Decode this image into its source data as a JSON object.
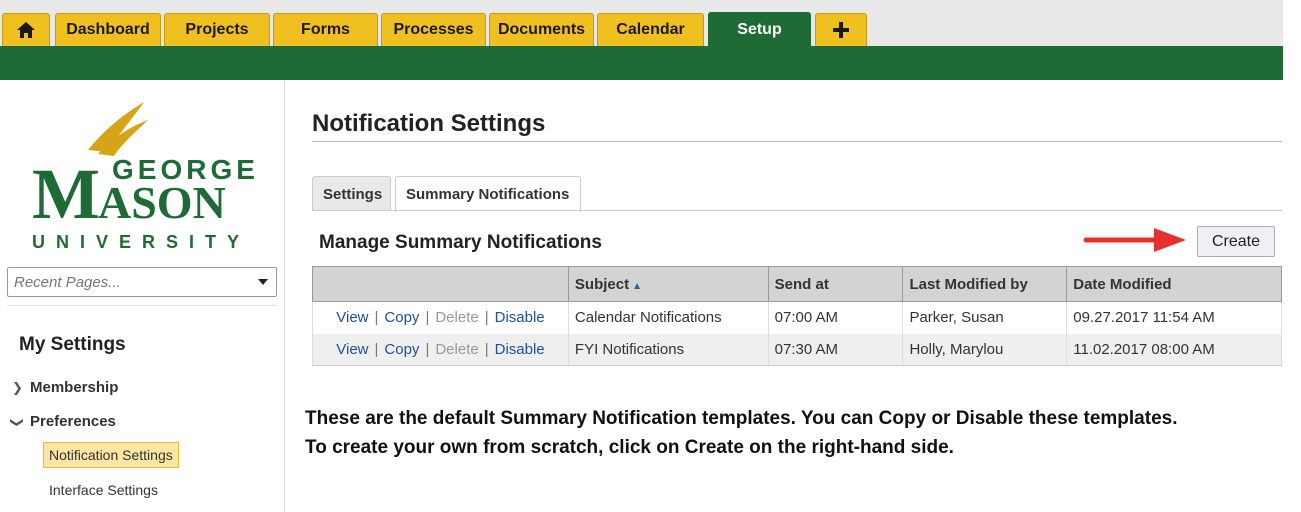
{
  "topnav": {
    "home_icon": "home-icon",
    "tabs": [
      "Dashboard",
      "Projects",
      "Forms",
      "Processes",
      "Documents",
      "Calendar",
      "Setup"
    ],
    "active_tab": "Setup",
    "add_icon": "plus-icon",
    "tab_color": "#f0c020",
    "active_color": "#1e6b35"
  },
  "sidebar": {
    "logo": {
      "line1": "GEORGE",
      "line2": "MASON",
      "line3": "UNIVERSITY"
    },
    "recent_placeholder": "Recent Pages...",
    "section_title": "My Settings",
    "items": [
      {
        "label": "Membership",
        "expanded": false
      },
      {
        "label": "Preferences",
        "expanded": true
      }
    ],
    "subitems": [
      {
        "label": "Notification Settings",
        "active": true
      },
      {
        "label": "Interface Settings",
        "active": false
      }
    ]
  },
  "main": {
    "page_title": "Notification Settings",
    "tabs": [
      {
        "label": "Settings",
        "active": false
      },
      {
        "label": "Summary Notifications",
        "active": true
      }
    ],
    "section_title": "Manage Summary Notifications",
    "create_label": "Create",
    "table": {
      "headers": [
        "",
        "Subject",
        "Send at",
        "Last Modified by",
        "Date Modified"
      ],
      "actions": [
        "View",
        "Copy",
        "Delete",
        "Disable"
      ],
      "rows": [
        {
          "subject": "Calendar Notifications",
          "send_at": "07:00 AM",
          "modified_by": "Parker, Susan",
          "date_modified": "09.27.2017 11:54 AM"
        },
        {
          "subject": "FYI Notifications",
          "send_at": "07:30 AM",
          "modified_by": "Holly, Marylou",
          "date_modified": "11.02.2017 08:00 AM"
        }
      ]
    }
  },
  "annotation": {
    "line1": "These are the default Summary Notification templates. You can Copy or Disable these templates.",
    "line2": "To create your own from scratch, click on Create on the right-hand side.",
    "arrow_color": "#e5322d"
  }
}
